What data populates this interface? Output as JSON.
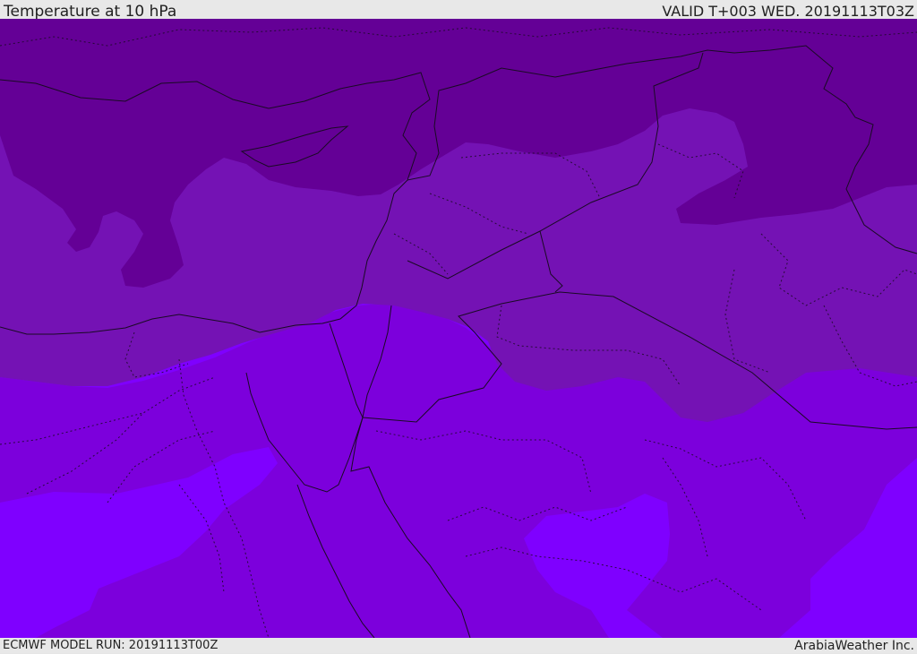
{
  "header": {
    "title": "Temperature at 10 hPa",
    "valid": "VALID T+003 WED. 20191113T03Z"
  },
  "footer": {
    "model_run": "ECMWF MODEL RUN: 20191113T00Z",
    "credit": "ArabiaWeather Inc."
  },
  "colors": {
    "band_darkest": "#640096",
    "band_dark": "#7412b4",
    "band_mid": "#7c00dc",
    "band_light": "#7f00ff",
    "lines": "#1a0a24"
  }
}
